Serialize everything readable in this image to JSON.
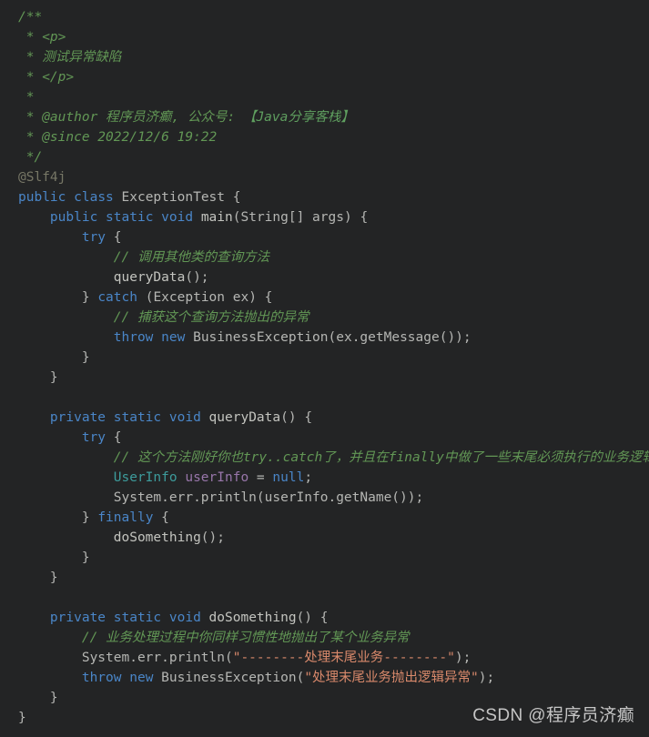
{
  "editor": {
    "background_color": "#232425",
    "font_size_px": 14.5,
    "line_height_px": 22,
    "language": "Java",
    "colors": {
      "comment": "#629755",
      "annotation": "#777766",
      "keyword": "#4a86c8",
      "class_name": "#3d9c9c",
      "field": "#9876aa",
      "method": "#c3c4bf",
      "string": "#d9896b",
      "plain": "#b5b6b3",
      "watermark": "#d3d3d3"
    }
  },
  "code": {
    "lines": [
      {
        "id": "l1",
        "indent": 0,
        "tokens": [
          {
            "t": "cmt",
            "v": "/**"
          }
        ]
      },
      {
        "id": "l2",
        "indent": 0,
        "tokens": [
          {
            "t": "cmt",
            "v": " * <p>"
          }
        ]
      },
      {
        "id": "l3",
        "indent": 0,
        "tokens": [
          {
            "t": "cmt",
            "v": " * 测试异常缺陷"
          }
        ]
      },
      {
        "id": "l4",
        "indent": 0,
        "tokens": [
          {
            "t": "cmt",
            "v": " * </p>"
          }
        ]
      },
      {
        "id": "l5",
        "indent": 0,
        "tokens": [
          {
            "t": "cmt",
            "v": " *"
          }
        ]
      },
      {
        "id": "l6",
        "indent": 0,
        "tokens": [
          {
            "t": "cmt",
            "v": " * @author 程序员济癫, 公众号: "
          },
          {
            "t": "cmttag",
            "v": "【Java分享客栈】"
          }
        ]
      },
      {
        "id": "l7",
        "indent": 0,
        "tokens": [
          {
            "t": "cmt",
            "v": " * @since 2022/12/6 19:22"
          }
        ]
      },
      {
        "id": "l8",
        "indent": 0,
        "tokens": [
          {
            "t": "cmt",
            "v": " */"
          }
        ]
      },
      {
        "id": "l9",
        "indent": 0,
        "tokens": [
          {
            "t": "anno",
            "v": "@Slf4j"
          }
        ]
      },
      {
        "id": "l10",
        "indent": 0,
        "tokens": [
          {
            "t": "kw",
            "v": "public"
          },
          {
            "t": "plain",
            "v": " "
          },
          {
            "t": "kw",
            "v": "class"
          },
          {
            "t": "plain",
            "v": " "
          },
          {
            "t": "type",
            "v": "ExceptionTest"
          },
          {
            "t": "plain",
            "v": " {"
          }
        ]
      },
      {
        "id": "l11",
        "indent": 1,
        "tokens": [
          {
            "t": "kw",
            "v": "public"
          },
          {
            "t": "plain",
            "v": " "
          },
          {
            "t": "kw",
            "v": "static"
          },
          {
            "t": "plain",
            "v": " "
          },
          {
            "t": "kw",
            "v": "void"
          },
          {
            "t": "plain",
            "v": " "
          },
          {
            "t": "mth",
            "v": "main"
          },
          {
            "t": "plain",
            "v": "("
          },
          {
            "t": "type",
            "v": "String[] args"
          },
          {
            "t": "plain",
            "v": ") {"
          }
        ]
      },
      {
        "id": "l12",
        "indent": 2,
        "tokens": [
          {
            "t": "kw",
            "v": "try"
          },
          {
            "t": "plain",
            "v": " {"
          }
        ]
      },
      {
        "id": "l13",
        "indent": 3,
        "tokens": [
          {
            "t": "cmt",
            "v": "// 调用其他类的查询方法"
          }
        ]
      },
      {
        "id": "l14",
        "indent": 3,
        "tokens": [
          {
            "t": "mth",
            "v": "queryData"
          },
          {
            "t": "plain",
            "v": "();"
          }
        ]
      },
      {
        "id": "l15",
        "indent": 2,
        "tokens": [
          {
            "t": "plain",
            "v": "} "
          },
          {
            "t": "kw",
            "v": "catch"
          },
          {
            "t": "plain",
            "v": " ("
          },
          {
            "t": "type",
            "v": "Exception ex"
          },
          {
            "t": "plain",
            "v": ") {"
          }
        ]
      },
      {
        "id": "l16",
        "indent": 3,
        "tokens": [
          {
            "t": "cmt",
            "v": "// 捕获这个查询方法抛出的异常"
          }
        ]
      },
      {
        "id": "l17",
        "indent": 3,
        "tokens": [
          {
            "t": "kw",
            "v": "throw"
          },
          {
            "t": "plain",
            "v": " "
          },
          {
            "t": "kw",
            "v": "new"
          },
          {
            "t": "plain",
            "v": " "
          },
          {
            "t": "type",
            "v": "BusinessException"
          },
          {
            "t": "plain",
            "v": "(ex.getMessage());"
          }
        ]
      },
      {
        "id": "l18",
        "indent": 2,
        "tokens": [
          {
            "t": "plain",
            "v": "}"
          }
        ]
      },
      {
        "id": "l19",
        "indent": 1,
        "tokens": [
          {
            "t": "plain",
            "v": "}"
          }
        ]
      },
      {
        "id": "l20",
        "indent": 0,
        "tokens": []
      },
      {
        "id": "l21",
        "indent": 1,
        "tokens": [
          {
            "t": "kw",
            "v": "private"
          },
          {
            "t": "plain",
            "v": " "
          },
          {
            "t": "kw",
            "v": "static"
          },
          {
            "t": "plain",
            "v": " "
          },
          {
            "t": "kw",
            "v": "void"
          },
          {
            "t": "plain",
            "v": " "
          },
          {
            "t": "mth",
            "v": "queryData"
          },
          {
            "t": "plain",
            "v": "() {"
          }
        ]
      },
      {
        "id": "l22",
        "indent": 2,
        "tokens": [
          {
            "t": "kw",
            "v": "try"
          },
          {
            "t": "plain",
            "v": " {"
          }
        ]
      },
      {
        "id": "l23",
        "indent": 3,
        "tokens": [
          {
            "t": "cmt",
            "v": "// 这个方法刚好你也try..catch了，并且在finally中做了一些末尾必须执行的业务逻辑处理。"
          }
        ]
      },
      {
        "id": "l24",
        "indent": 3,
        "tokens": [
          {
            "t": "cls",
            "v": "UserInfo"
          },
          {
            "t": "plain",
            "v": " "
          },
          {
            "t": "field",
            "v": "userInfo"
          },
          {
            "t": "plain",
            "v": " = "
          },
          {
            "t": "kw",
            "v": "null"
          },
          {
            "t": "plain",
            "v": ";"
          }
        ]
      },
      {
        "id": "l25",
        "indent": 3,
        "tokens": [
          {
            "t": "plain",
            "v": "System.err.println(userInfo.getName());"
          }
        ]
      },
      {
        "id": "l26",
        "indent": 2,
        "tokens": [
          {
            "t": "plain",
            "v": "} "
          },
          {
            "t": "kw",
            "v": "finally"
          },
          {
            "t": "plain",
            "v": " {"
          }
        ]
      },
      {
        "id": "l27",
        "indent": 3,
        "tokens": [
          {
            "t": "mth",
            "v": "doSomething"
          },
          {
            "t": "plain",
            "v": "();"
          }
        ]
      },
      {
        "id": "l28",
        "indent": 2,
        "tokens": [
          {
            "t": "plain",
            "v": "}"
          }
        ]
      },
      {
        "id": "l29",
        "indent": 1,
        "tokens": [
          {
            "t": "plain",
            "v": "}"
          }
        ]
      },
      {
        "id": "l30",
        "indent": 0,
        "tokens": []
      },
      {
        "id": "l31",
        "indent": 1,
        "tokens": [
          {
            "t": "kw",
            "v": "private"
          },
          {
            "t": "plain",
            "v": " "
          },
          {
            "t": "kw",
            "v": "static"
          },
          {
            "t": "plain",
            "v": " "
          },
          {
            "t": "kw",
            "v": "void"
          },
          {
            "t": "plain",
            "v": " "
          },
          {
            "t": "mth",
            "v": "doSomething"
          },
          {
            "t": "plain",
            "v": "() {"
          }
        ]
      },
      {
        "id": "l32",
        "indent": 2,
        "tokens": [
          {
            "t": "cmt",
            "v": "// 业务处理过程中你同样习惯性地抛出了某个业务异常"
          }
        ]
      },
      {
        "id": "l33",
        "indent": 2,
        "tokens": [
          {
            "t": "plain",
            "v": "System.err.println("
          },
          {
            "t": "str",
            "v": "\"--------处理末尾业务--------\""
          },
          {
            "t": "plain",
            "v": ");"
          }
        ]
      },
      {
        "id": "l34",
        "indent": 2,
        "tokens": [
          {
            "t": "kw",
            "v": "throw"
          },
          {
            "t": "plain",
            "v": " "
          },
          {
            "t": "kw",
            "v": "new"
          },
          {
            "t": "plain",
            "v": " "
          },
          {
            "t": "type",
            "v": "BusinessException"
          },
          {
            "t": "plain",
            "v": "("
          },
          {
            "t": "str",
            "v": "\"处理末尾业务抛出逻辑异常\""
          },
          {
            "t": "plain",
            "v": ");"
          }
        ]
      },
      {
        "id": "l35",
        "indent": 1,
        "tokens": [
          {
            "t": "plain",
            "v": "}"
          }
        ]
      },
      {
        "id": "l36",
        "indent": 0,
        "tokens": [
          {
            "t": "plain",
            "v": "}"
          }
        ]
      }
    ]
  },
  "watermark": {
    "text": "CSDN @程序员济癫"
  }
}
